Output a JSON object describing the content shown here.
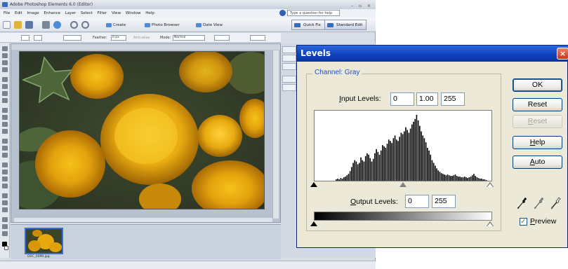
{
  "app": {
    "title": "Adobe Photoshop Elements 6.0 (Editor)",
    "menus": [
      "File",
      "Edit",
      "Image",
      "Enhance",
      "Layer",
      "Select",
      "Filter",
      "View",
      "Window",
      "Help"
    ],
    "help_search_placeholder": "Type a question for help",
    "toolbar": {
      "create": "Create",
      "photo_browser": "Photo Browser",
      "date_view": "Date View",
      "quick_fix": "Quick Fix",
      "standard_edit": "Standard Edit"
    },
    "options": {
      "feather_label": "Feather:",
      "feather_value": "0 px",
      "anti_alias": "Anti-alias",
      "mode_label": "Mode:",
      "mode_value": "Normal"
    },
    "bin_caption": "DSC_0099.jpg"
  },
  "dialog": {
    "title": "Levels",
    "close_glyph": "×",
    "channel_legend": "Channel: Gray",
    "input_levels_label_u": "I",
    "input_levels_label_rest": "nput Levels:",
    "input_black": "0",
    "input_gamma": "1.00",
    "input_white": "255",
    "output_levels_label_u": "O",
    "output_levels_label_rest": "utput Levels:",
    "output_black": "0",
    "output_white": "255",
    "buttons": {
      "ok": "OK",
      "reset": "Reset",
      "reset2_u": "R",
      "reset2_rest": "eset",
      "help_u": "H",
      "help_rest": "elp",
      "auto_u": "A",
      "auto_rest": "uto"
    },
    "preview_label_u": "P",
    "preview_label_rest": "review",
    "preview_checked": true,
    "histogram": [
      2,
      3,
      2,
      4,
      3,
      5,
      6,
      8,
      10,
      14,
      20,
      26,
      30,
      28,
      24,
      26,
      34,
      30,
      28,
      36,
      40,
      38,
      33,
      28,
      32,
      40,
      46,
      42,
      38,
      44,
      52,
      50,
      48,
      54,
      60,
      58,
      55,
      62,
      66,
      60,
      58,
      64,
      70,
      68,
      72,
      78,
      74,
      70,
      76,
      82,
      86,
      90,
      96,
      88,
      80,
      72,
      66,
      62,
      56,
      48,
      44,
      38,
      30,
      26,
      22,
      18,
      15,
      13,
      11,
      10,
      9,
      8,
      9,
      8,
      7,
      7,
      8,
      9,
      7,
      6,
      6,
      5,
      5,
      6,
      5,
      4,
      5,
      6,
      8,
      10,
      7,
      5,
      4,
      3,
      3,
      2,
      2,
      1
    ]
  }
}
